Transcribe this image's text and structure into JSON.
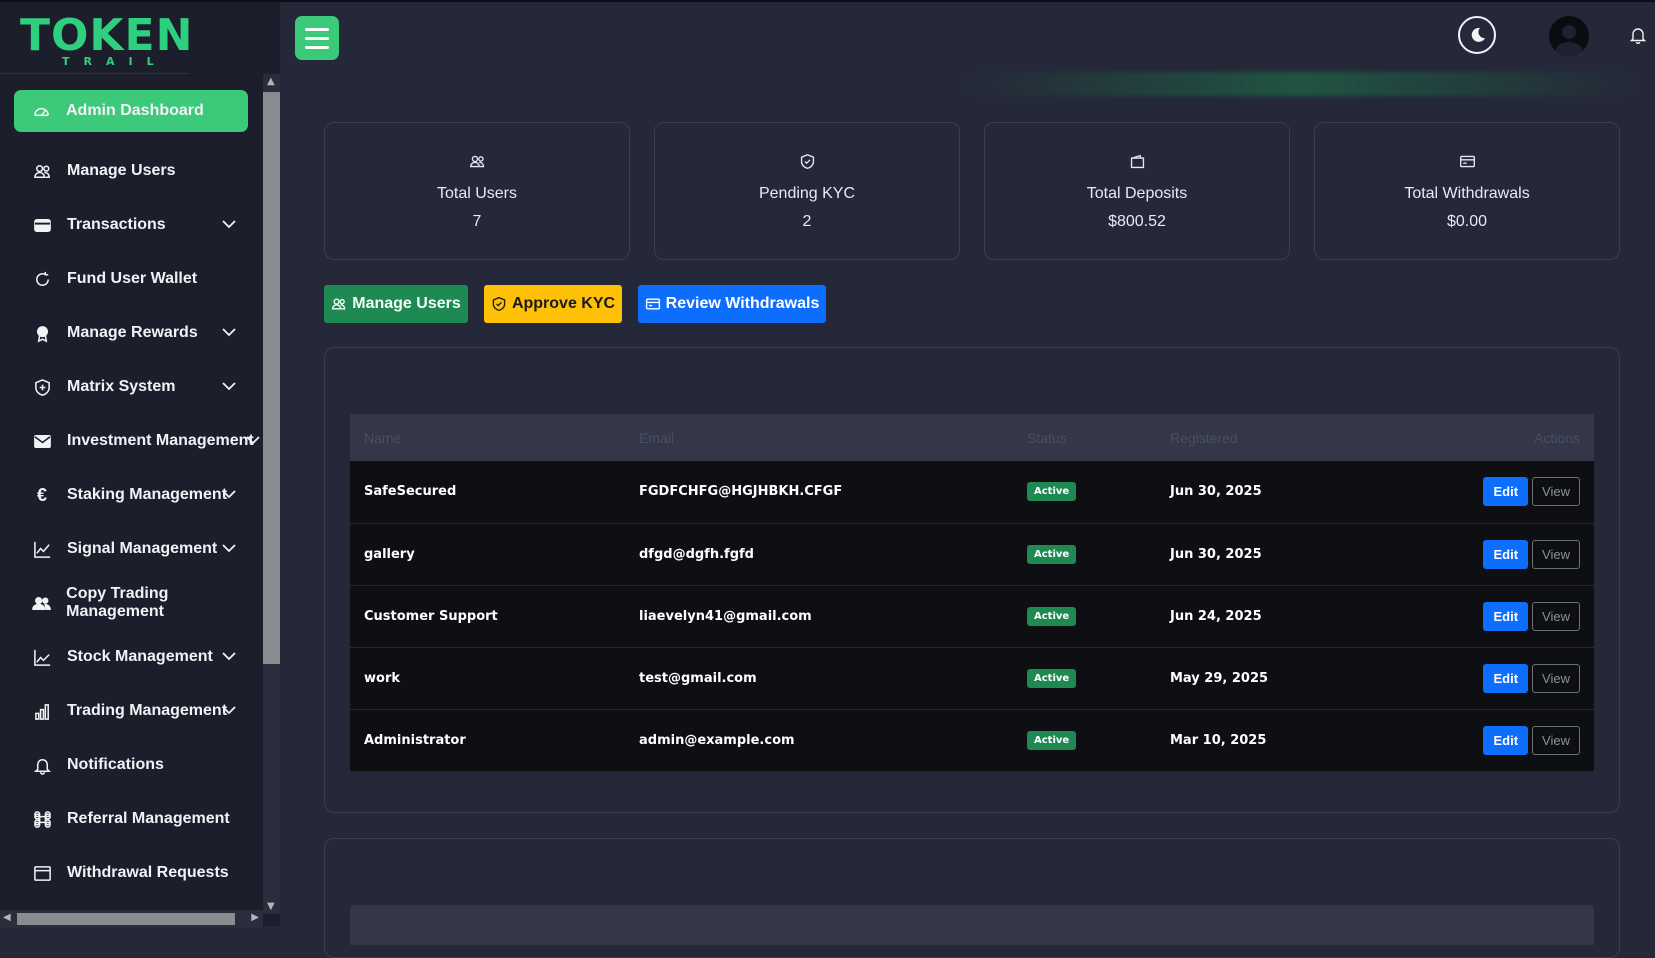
{
  "brand": {
    "name": "TOKEN",
    "tagline": "TRAIL"
  },
  "colors": {
    "accent": "#3cc97a",
    "primary": "#0d6efd",
    "warning": "#ffc107",
    "success": "#1e8a52",
    "background": "#252838",
    "sidebar": "#1c1e2b"
  },
  "header": {
    "menu_icon": "hamburger-icon",
    "theme_icon": "moon-icon",
    "avatar_icon": "user-avatar",
    "bell_icon": "bell-icon"
  },
  "sidebar": {
    "items": [
      {
        "label": "Admin Dashboard",
        "icon": "speedometer-icon",
        "expandable": false,
        "active": true
      },
      {
        "label": "Manage Users",
        "icon": "users-icon",
        "expandable": false
      },
      {
        "label": "Transactions",
        "icon": "card-icon",
        "expandable": true
      },
      {
        "label": "Fund User Wallet",
        "icon": "refresh-icon",
        "expandable": false
      },
      {
        "label": "Manage Rewards",
        "icon": "award-icon",
        "expandable": true
      },
      {
        "label": "Matrix System",
        "icon": "shield-icon",
        "expandable": true
      },
      {
        "label": "Investment Management",
        "icon": "envelope-icon",
        "expandable": true
      },
      {
        "label": "Staking Management",
        "icon": "euro-icon",
        "expandable": true
      },
      {
        "label": "Signal Management",
        "icon": "graph-up-icon",
        "expandable": true
      },
      {
        "label": "Copy Trading Management",
        "icon": "people-icon",
        "expandable": true
      },
      {
        "label": "Stock Management",
        "icon": "graph-icon",
        "expandable": true
      },
      {
        "label": "Trading Management",
        "icon": "bar-chart-icon",
        "expandable": true
      },
      {
        "label": "Notifications",
        "icon": "bell-icon",
        "expandable": false
      },
      {
        "label": "Referral Management",
        "icon": "command-icon",
        "expandable": false
      },
      {
        "label": "Withdrawal Requests",
        "icon": "window-icon",
        "expandable": false
      }
    ]
  },
  "stats": [
    {
      "label": "Total Users",
      "value": "7",
      "icon": "users-icon"
    },
    {
      "label": "Pending KYC",
      "value": "2",
      "icon": "shield-check-icon"
    },
    {
      "label": "Total Deposits",
      "value": "$800.52",
      "icon": "wallet-icon"
    },
    {
      "label": "Total Withdrawals",
      "value": "$0.00",
      "icon": "credit-card-icon"
    }
  ],
  "actions": {
    "manage_users": "Manage Users",
    "approve_kyc": "Approve KYC",
    "review_withdrawals": "Review Withdrawals"
  },
  "users_table": {
    "columns": [
      "Name",
      "Email",
      "Status",
      "Registered",
      "Actions"
    ],
    "rows": [
      {
        "name": "SafeSecured",
        "email": "FGDFCHFG@HGJHBKH.CFGF",
        "status": "Active",
        "registered": "Jun 30, 2025"
      },
      {
        "name": "gallery",
        "email": "dfgd@dgfh.fgfd",
        "status": "Active",
        "registered": "Jun 30, 2025"
      },
      {
        "name": "Customer Support",
        "email": "liaevelyn41@gmail.com",
        "status": "Active",
        "registered": "Jun 24, 2025"
      },
      {
        "name": "work",
        "email": "test@gmail.com",
        "status": "Active",
        "registered": "May 29, 2025"
      },
      {
        "name": "Administrator",
        "email": "admin@example.com",
        "status": "Active",
        "registered": "Mar 10, 2025"
      }
    ],
    "edit_label": "Edit",
    "view_label": "View"
  }
}
